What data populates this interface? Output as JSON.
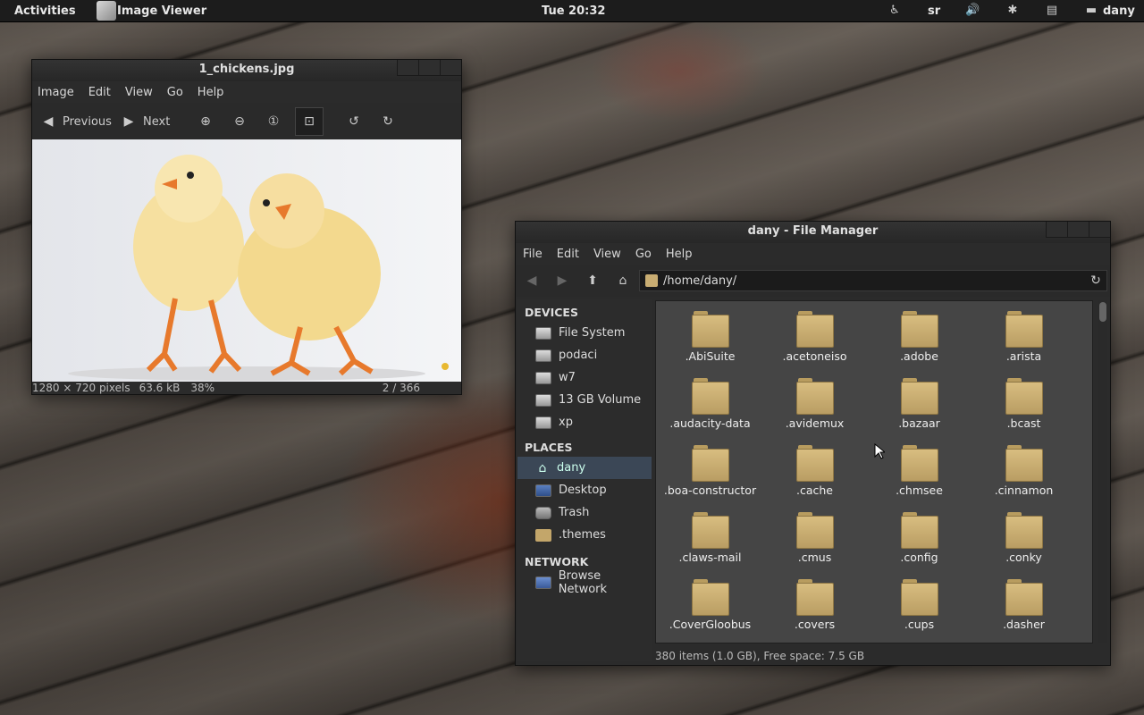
{
  "panel": {
    "activities": "Activities",
    "app_name": "Image Viewer",
    "clock": "Tue 20:32",
    "keyboard": "sr",
    "user": "dany",
    "icons": [
      "accessibility-icon",
      "volume-icon",
      "bluetooth-icon",
      "clipboard-icon",
      "chat-icon"
    ]
  },
  "viewer": {
    "title": "1_chickens.jpg",
    "menu": [
      "Image",
      "Edit",
      "View",
      "Go",
      "Help"
    ],
    "toolbar": {
      "previous": "Previous",
      "next": "Next",
      "icons": [
        "zoom-in-icon",
        "zoom-out-icon",
        "zoom-normal-icon",
        "fit-icon",
        "rotate-left-icon",
        "rotate-right-icon"
      ]
    },
    "status": {
      "dimensions": "1280 × 720 pixels",
      "size": "63.6 kB",
      "zoom": "38%",
      "position": "2 / 366"
    },
    "colors": {
      "image_bg": "#e9eaee",
      "chick": "#f3d98e",
      "beak": "#e7792c"
    }
  },
  "fm": {
    "title": "dany - File Manager",
    "menu": [
      "File",
      "Edit",
      "View",
      "Go",
      "Help"
    ],
    "path": "/home/dany/",
    "sidebar": {
      "devices_header": "DEVICES",
      "devices": [
        "File System",
        "podaci",
        "w7",
        "13 GB Volume",
        "xp"
      ],
      "places_header": "PLACES",
      "places": [
        {
          "label": "dany",
          "icon": "home-icon",
          "selected": true
        },
        {
          "label": "Desktop",
          "icon": "desktop-icon",
          "selected": false
        },
        {
          "label": "Trash",
          "icon": "trash-icon",
          "selected": false
        },
        {
          "label": ".themes",
          "icon": "folder-icon",
          "selected": false
        }
      ],
      "network_header": "NETWORK",
      "network": [
        "Browse Network"
      ]
    },
    "files": [
      ".AbiSuite",
      ".acetoneiso",
      ".adobe",
      ".arista",
      ".audacity-data",
      ".avidemux",
      ".bazaar",
      ".bcast",
      ".boa-constructor",
      ".cache",
      ".chmsee",
      ".cinnamon",
      ".claws-mail",
      ".cmus",
      ".config",
      ".conky",
      ".CoverGloobus",
      ".covers",
      ".cups",
      ".dasher"
    ],
    "status": "380 items (1.0 GB), Free space: 7.5 GB",
    "colors": {
      "folder": "#c9ad72",
      "selection": "#3b4756"
    }
  }
}
